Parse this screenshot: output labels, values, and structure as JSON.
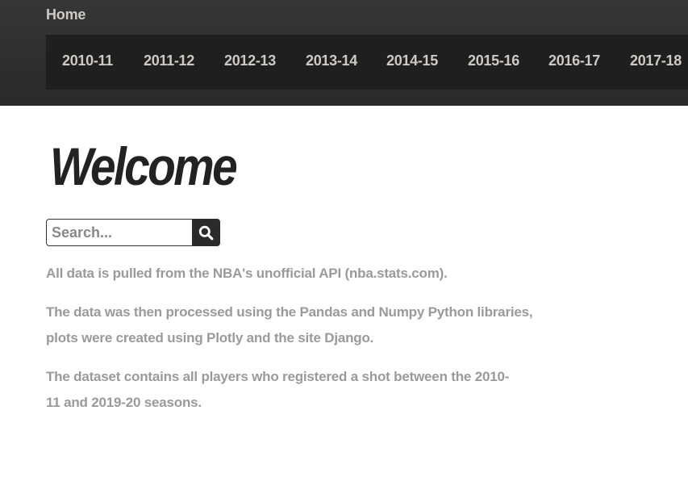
{
  "header": {
    "home_label": "Home",
    "seasons": [
      {
        "label": "2010-11"
      },
      {
        "label": "2011-12"
      },
      {
        "label": "2012-13"
      },
      {
        "label": "2013-14"
      },
      {
        "label": "2014-15"
      },
      {
        "label": "2015-16"
      },
      {
        "label": "2016-17"
      },
      {
        "label": "2017-18"
      }
    ]
  },
  "main": {
    "title": "Welcome",
    "search": {
      "placeholder": "Search...",
      "value": "",
      "button_icon": "search-icon"
    },
    "paragraphs": [
      "All data is pulled from the NBA's unofficial API (nba.stats.com).",
      "The data was then processed using the Pandas and Numpy Python libraries, plots were created using Plotly and the site Django.",
      "The dataset contains all players who registered a shot between the 2010-11 and 2019-20 seasons."
    ]
  },
  "colors": {
    "header_bg": "#333333",
    "nav_bg": "#1f1f1f",
    "nav_text": "#cfc9c4",
    "title_text": "#222222",
    "body_text": "#9a9a9a",
    "search_button_bg": "#2b2b2b"
  }
}
